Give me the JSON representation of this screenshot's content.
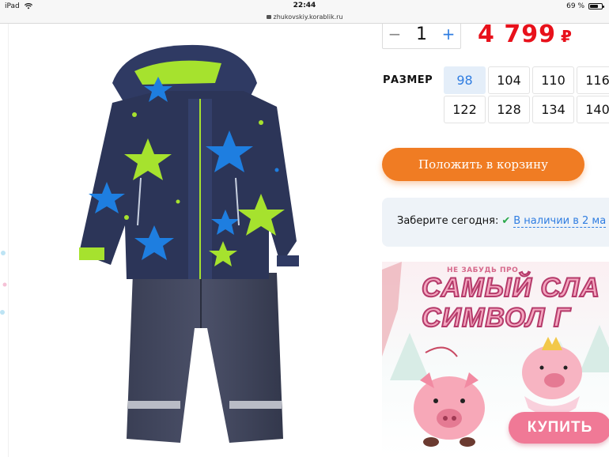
{
  "status_bar": {
    "device": "iPad",
    "time": "22:44",
    "battery": "69 %",
    "battery_level": 0.69
  },
  "browser": {
    "url": "zhukovskiy.korablik.ru"
  },
  "product": {
    "quantity": "1",
    "qty_minus": "−",
    "qty_plus": "+",
    "price": "4 799",
    "currency": "₽",
    "size_label": "РАЗМЕР",
    "sizes": [
      "98",
      "104",
      "110",
      "116",
      "122",
      "128",
      "134",
      "140"
    ],
    "selected_size": "98",
    "add_to_cart": "Положить в корзину",
    "pickup_label": "Заберите сегодня:",
    "pickup_status": "В наличии в 2 ма"
  },
  "banner": {
    "sub": "НЕ ЗАБУДЬ ПРО",
    "line1": "САМЫЙ СЛА",
    "line2": "СИМВОЛ Г",
    "buy": "КУПИТЬ"
  },
  "colors": {
    "price": "#e8111b",
    "accent_orange": "#f07c23",
    "link_blue": "#2f7de1",
    "banner_pink": "#f07996"
  }
}
